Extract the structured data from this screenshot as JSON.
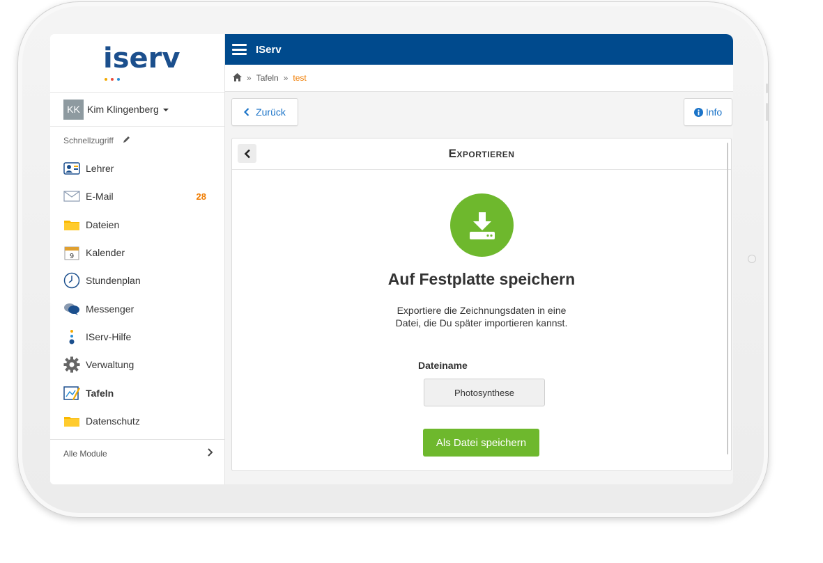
{
  "logo": {
    "text": "iserv"
  },
  "user": {
    "initials": "KK",
    "name": "Kim Klingenberg"
  },
  "sidebar": {
    "quick_access": "Schnellzugriff",
    "items": [
      {
        "label": "Lehrer",
        "icon": "contact-card-icon"
      },
      {
        "label": "E-Mail",
        "icon": "envelope-icon",
        "badge": "28"
      },
      {
        "label": "Dateien",
        "icon": "folder-icon"
      },
      {
        "label": "Kalender",
        "icon": "calendar-icon"
      },
      {
        "label": "Stundenplan",
        "icon": "clock-icon"
      },
      {
        "label": "Messenger",
        "icon": "chat-bubbles-icon"
      },
      {
        "label": "IServ-Hilfe",
        "icon": "help-dots-icon"
      },
      {
        "label": "Verwaltung",
        "icon": "gear-icon"
      },
      {
        "label": "Tafeln",
        "icon": "whiteboard-icon",
        "active": true
      },
      {
        "label": "Datenschutz",
        "icon": "folder-icon"
      }
    ],
    "all_modules": "Alle Module"
  },
  "header": {
    "title": "IServ"
  },
  "breadcrumb": {
    "items": [
      "Tafeln",
      "test"
    ],
    "separator": "»"
  },
  "toolbar": {
    "back_label": "Zurück",
    "info_label": "Info"
  },
  "panel": {
    "title": "Exportieren",
    "heading": "Auf Festplatte speichern",
    "description": "Exportiere die Zeichnungsdaten in eine Datei, die Du später importieren kannst.",
    "filename_label": "Dateiname",
    "filename_value": "Photosynthese",
    "save_label": "Als Datei speichern"
  },
  "colors": {
    "header": "#004a8d",
    "accent_green": "#6eb82d",
    "badge_orange": "#f07c00",
    "link_blue": "#1a73c8"
  }
}
